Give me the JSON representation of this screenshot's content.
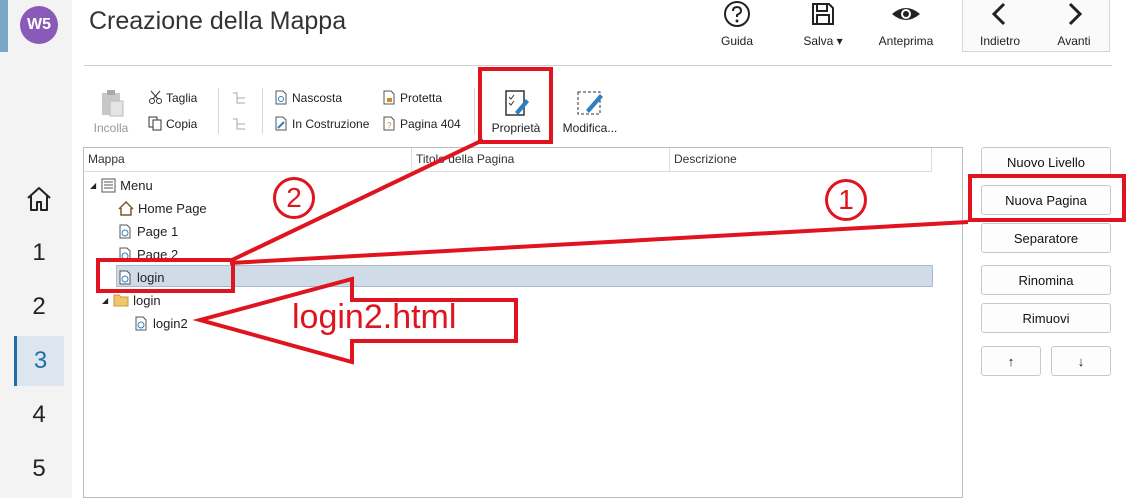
{
  "app": {
    "logo_text": "W5",
    "title": "Creazione della Mappa"
  },
  "header_buttons": [
    {
      "label": "Guida",
      "icon": "help-icon"
    },
    {
      "label": "Salva ▾",
      "icon": "save-icon"
    },
    {
      "label": "Anteprima",
      "icon": "eye-icon"
    },
    {
      "label": "Indietro",
      "icon": "chevron-left-icon"
    },
    {
      "label": "Avanti",
      "icon": "chevron-right-icon"
    }
  ],
  "steps": [
    "1",
    "2",
    "3",
    "4",
    "5"
  ],
  "active_step": "3",
  "toolbar": {
    "paste": "Incolla",
    "cut": "Taglia",
    "copy": "Copia",
    "hidden": "Nascosta",
    "under_construction": "In Costruzione",
    "protected": "Protetta",
    "page404": "Pagina 404",
    "properties": "Proprietà",
    "edit": "Modifica..."
  },
  "columns": [
    "Mappa",
    "Titolo della Pagina",
    "Descrizione"
  ],
  "tree": [
    {
      "label": "Menu",
      "icon": "menu-icon"
    },
    {
      "label": "Home Page",
      "icon": "home-icon"
    },
    {
      "label": "Page 1",
      "icon": "page-icon"
    },
    {
      "label": "Page 2",
      "icon": "page-icon"
    },
    {
      "label": "login",
      "icon": "page-icon",
      "selected": true
    },
    {
      "label": "login",
      "icon": "folder-icon"
    },
    {
      "label": "login2",
      "icon": "page-icon"
    }
  ],
  "side_buttons": {
    "new_level": "Nuovo Livello",
    "new_page": "Nuova Pagina",
    "separator": "Separatore",
    "rename": "Rinomina",
    "remove": "Rimuovi",
    "up": "↑",
    "down": "↓"
  },
  "annotations": {
    "circle1": "1",
    "circle2": "2",
    "arrow_text": "login2.html",
    "color": "#e0141e"
  }
}
